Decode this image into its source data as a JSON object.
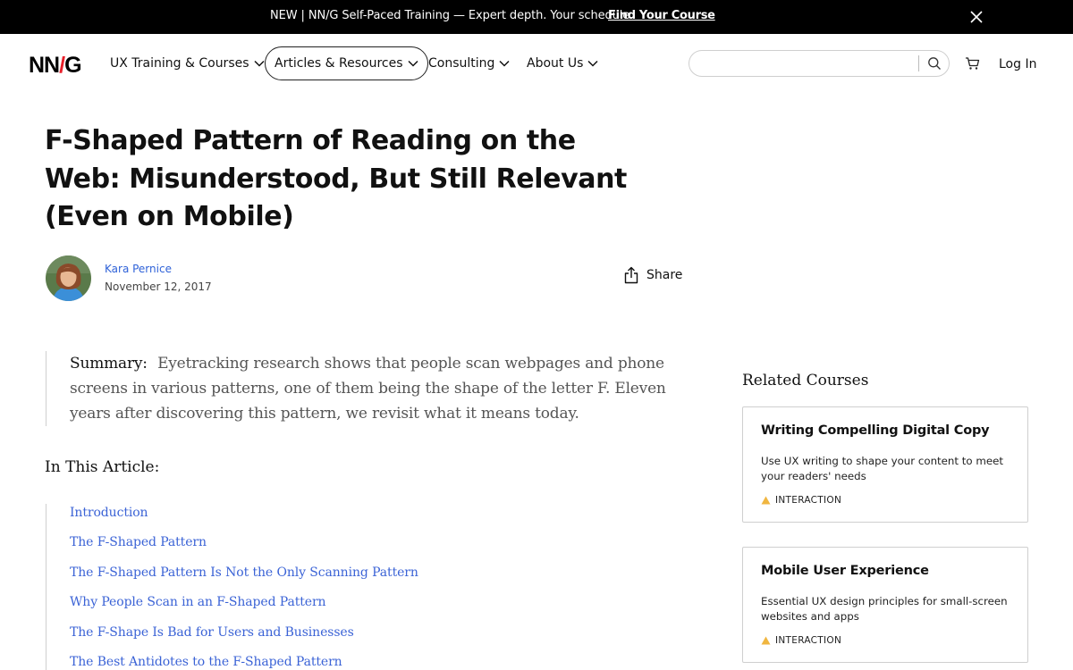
{
  "announcement": {
    "text": "NEW | NN/G Self-Paced Training — Expert depth. Your schedule.",
    "link_label": "Find Your Course"
  },
  "logo": {
    "prefix": "NN",
    "slash": "/",
    "suffix": "G"
  },
  "nav": {
    "items": [
      {
        "label": "UX Training & Courses"
      },
      {
        "label": "Articles & Resources"
      },
      {
        "label": "Consulting"
      },
      {
        "label": "About Us"
      }
    ],
    "active_index": 1,
    "search": {
      "value": "",
      "placeholder": ""
    },
    "login_label": "Log In"
  },
  "article": {
    "title": "F-Shaped Pattern of Reading on the Web: Misunderstood, But Still Relevant (Even on Mobile)",
    "author": "Kara Pernice",
    "date": "November 12, 2017",
    "share_label": "Share",
    "summary_label": "Summary:",
    "summary_text": "Eyetracking research shows that people scan webpages and phone screens in various patterns, one of them being the shape of the letter F. Eleven years after discovering this pattern, we revisit what it means today.",
    "toc_heading": "In This Article:",
    "toc": [
      "Introduction",
      "The F-Shaped Pattern",
      "The F-Shaped Pattern Is Not the Only Scanning Pattern",
      "Why People Scan in an F-Shaped Pattern",
      "The F-Shape Is Bad for Users and Businesses",
      "The Best Antidotes to the F-Shaped Pattern"
    ]
  },
  "related": {
    "heading": "Related Courses",
    "courses": [
      {
        "title": "Writing Compelling Digital Copy",
        "description": "Use UX writing to shape your content to meet your readers' needs",
        "tag": "INTERACTION"
      },
      {
        "title": "Mobile User Experience",
        "description": "Essential UX design principles for small-screen websites and apps",
        "tag": "INTERACTION"
      }
    ]
  },
  "colors": {
    "accent_link": "#3b63d6",
    "logo_slash": "#e8202a",
    "tag_triangle": "#f0b640",
    "announcement_bg": "#000000"
  },
  "icons": {
    "close": "close-icon",
    "chevron": "chevron-down-icon",
    "search": "search-icon",
    "cart": "cart-icon",
    "share": "share-icon",
    "tag": "triangle-icon"
  }
}
